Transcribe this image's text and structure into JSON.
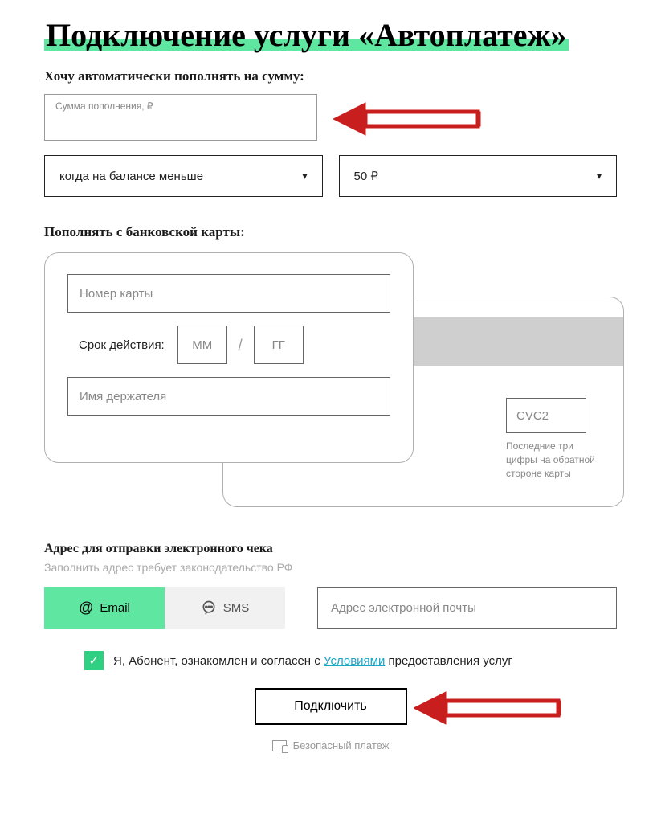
{
  "title": "Подключение услуги «Автоплатеж»",
  "amount_section": {
    "label": "Хочу автоматически пополнять на сумму:",
    "placeholder": "Сумма пополнения, ₽"
  },
  "condition_dropdown": {
    "text": "когда на балансе меньше"
  },
  "threshold_dropdown": {
    "text": "50 ₽"
  },
  "card_section": {
    "label": "Пополнять с банковской карты:",
    "number_placeholder": "Номер карты",
    "expiry_label": "Срок действия:",
    "mm_placeholder": "ММ",
    "separator": "/",
    "yy_placeholder": "ГГ",
    "holder_placeholder": "Имя держателя",
    "cvc_placeholder": "CVC2",
    "cvc_hint": "Последние три цифры на обратной стороне карты"
  },
  "receipt": {
    "title": "Адрес для отправки электронного чека",
    "subtitle": "Заполнить адрес требует законодательство РФ",
    "email_tab": "Email",
    "sms_tab": "SMS",
    "email_placeholder": "Адрес электронной почты"
  },
  "agree": {
    "prefix": "Я, Абонент, ознакомлен и согласен с ",
    "link": "Условиями",
    "suffix": " предоставления услуг"
  },
  "submit": "Подключить",
  "secure": "Безопасный платеж"
}
